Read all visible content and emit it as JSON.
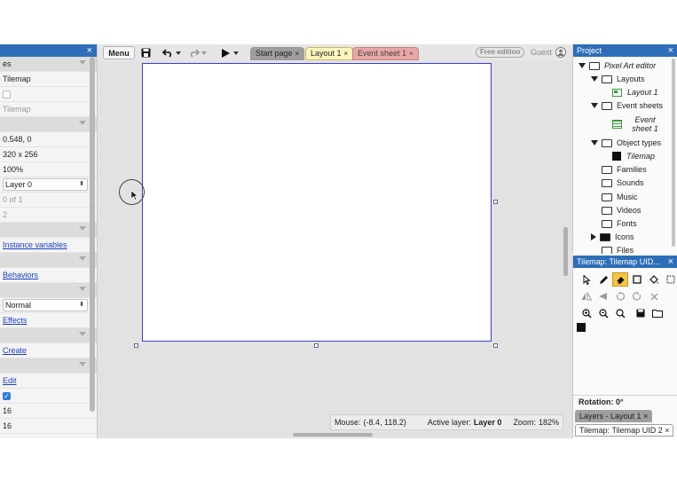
{
  "left_panel": {
    "close_icon": "×",
    "rows": [
      {
        "type": "head",
        "text": "es"
      },
      {
        "type": "text",
        "text": "Tilemap"
      },
      {
        "type": "checkbox",
        "checked": false
      },
      {
        "type": "grey",
        "text": "Tilemap"
      },
      {
        "type": "head",
        "text": ""
      },
      {
        "type": "text",
        "text": "0.548, 0"
      },
      {
        "type": "text",
        "text": "320 x 256"
      },
      {
        "type": "text",
        "text": "100%"
      },
      {
        "type": "select",
        "text": "Layer 0"
      },
      {
        "type": "grey",
        "text": "0 of 1"
      },
      {
        "type": "grey",
        "text": "2"
      },
      {
        "type": "head",
        "text": ""
      },
      {
        "type": "link",
        "text": "Instance variables"
      },
      {
        "type": "head",
        "text": ""
      },
      {
        "type": "link",
        "text": "Behaviors"
      },
      {
        "type": "head",
        "text": ""
      },
      {
        "type": "select",
        "text": "Normal"
      },
      {
        "type": "link",
        "text": "Effects"
      },
      {
        "type": "head",
        "text": ""
      },
      {
        "type": "link",
        "text": "Create"
      },
      {
        "type": "head",
        "text": ""
      },
      {
        "type": "link",
        "text": "Edit"
      },
      {
        "type": "checkbox",
        "checked": true
      },
      {
        "type": "text",
        "text": "16"
      },
      {
        "type": "text",
        "text": "16"
      }
    ]
  },
  "toolbar": {
    "menu_label": "Menu",
    "tabs": [
      {
        "label": "Start page",
        "close": "×"
      },
      {
        "label": "Layout 1",
        "close": "×"
      },
      {
        "label": "Event sheet 1",
        "close": "×"
      }
    ],
    "free_badge": "Free edition",
    "guest_label": "Guest"
  },
  "status_bar": {
    "mouse_label": "Mouse:",
    "mouse_value": "(-8.4, 118.2)",
    "layer_label": "Active layer:",
    "layer_value": "Layer 0",
    "zoom_label": "Zoom:",
    "zoom_value": "182%"
  },
  "project_panel": {
    "title": "Project",
    "close_icon": "×",
    "items": {
      "root": "Pixel Art editor",
      "layouts": "Layouts",
      "layout1": "Layout 1",
      "event_sheets": "Event sheets",
      "event_sheet1": "Event sheet 1",
      "object_types": "Object types",
      "tilemap": "Tilemap",
      "families": "Families",
      "sounds": "Sounds",
      "music": "Music",
      "videos": "Videos",
      "fonts": "Fonts",
      "icons": "Icons",
      "files": "Files"
    }
  },
  "tilemap_panel": {
    "title": "Tilemap: Tilemap UID...",
    "close_icon": "×",
    "rotation_label": "Rotation: 0°",
    "tab_layers": "Layers - Layout 1",
    "tab_tilemap": "Tilemap: Tilemap UID 2",
    "close_x": "×"
  },
  "colors": {
    "panel_title": "#2e6eb8",
    "layout_border": "#3c3fc8",
    "active_tool": "#f5c542",
    "tab_layout": "#fff6bf",
    "tab_events": "#e9a6a6"
  }
}
